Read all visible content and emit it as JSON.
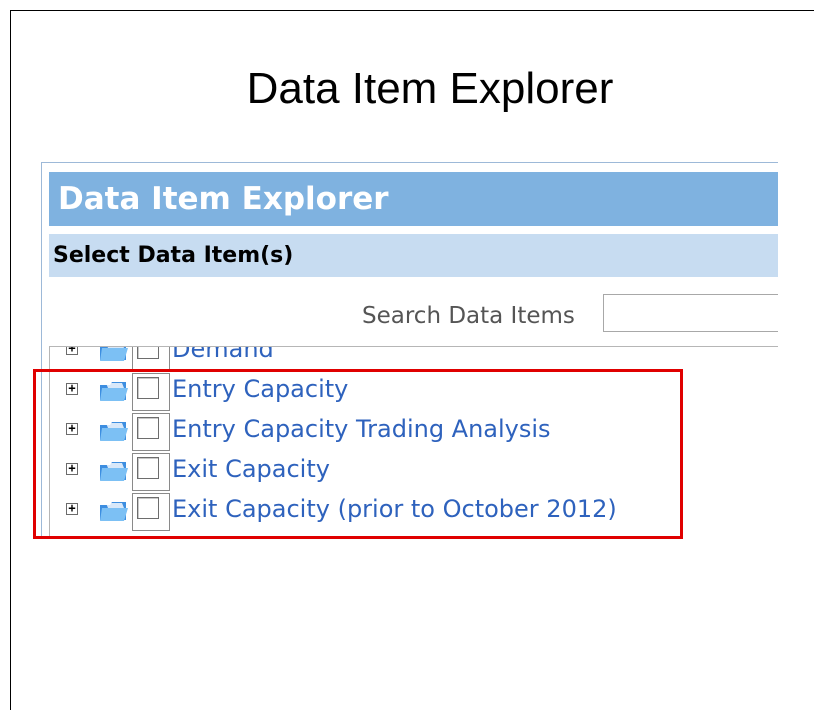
{
  "slide": {
    "title": "Data Item Explorer"
  },
  "panel": {
    "header": "Data Item Explorer",
    "subheader": "Select Data Item(s)"
  },
  "search": {
    "label": "Search Data Items",
    "value": ""
  },
  "tree": {
    "items": [
      {
        "label": "Demand",
        "expander": "+"
      },
      {
        "label": "Entry Capacity",
        "expander": "+"
      },
      {
        "label": "Entry Capacity Trading Analysis",
        "expander": "+"
      },
      {
        "label": "Exit Capacity",
        "expander": "+"
      },
      {
        "label": "Exit Capacity (prior to October 2012)",
        "expander": "+"
      }
    ]
  },
  "colors": {
    "header_bg": "#7fb2e0",
    "subheader_bg": "#c7dcf1",
    "link": "#2e62bd",
    "highlight": "#e00000"
  }
}
